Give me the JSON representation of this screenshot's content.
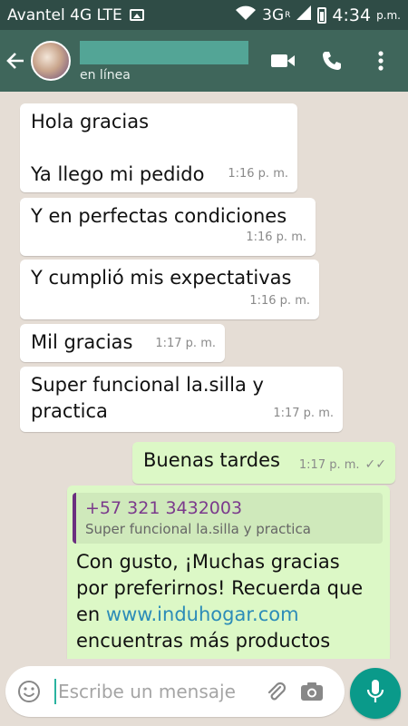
{
  "status_bar": {
    "carrier": "Avantel 4G LTE",
    "network": "3G",
    "network_sup": "R",
    "time": "4:34",
    "ampm": "p.m."
  },
  "header": {
    "contact_status": "en línea"
  },
  "messages": [
    {
      "direction": "in",
      "lines": [
        "Hola gracias",
        "",
        "Ya llego mi pedido"
      ],
      "time": "1:16 p. m."
    },
    {
      "direction": "in",
      "text": "Y en perfectas condiciones",
      "time": "1:16 p. m."
    },
    {
      "direction": "in",
      "text": "Y cumplió mis expectativas",
      "time": "1:16 p. m."
    },
    {
      "direction": "in",
      "text": "Mil gracias",
      "time": "1:17 p. m."
    },
    {
      "direction": "in",
      "lines": [
        "Super funcional la.silla y",
        "practica"
      ],
      "time": "1:17 p. m."
    },
    {
      "direction": "out",
      "text": "Buenas tardes",
      "time": "1:17 p. m."
    },
    {
      "direction": "out",
      "quote": {
        "sender": "+57 321 3432003",
        "text": "Super funcional la.silla y practica"
      },
      "lines": [
        "Con gusto, ¡Muchas gracias",
        "por preferirnos! Recuerda que"
      ],
      "line3_prefix": "en ",
      "link": "www.induhogar.com",
      "line4": "encuentras más productos"
    }
  ],
  "composer": {
    "placeholder": "Escribe un mensaje"
  },
  "colors": {
    "status_bar": "#2f4c46",
    "header": "#3f665b",
    "chat_bg": "#e5ddd5",
    "incoming": "#ffffff",
    "outgoing": "#dcf8c6",
    "mic_button": "#0a9a8a"
  },
  "icons": [
    "back-arrow-icon",
    "video-call-icon",
    "phone-icon",
    "more-options-icon",
    "emoji-icon",
    "attach-icon",
    "camera-icon",
    "mic-icon"
  ]
}
